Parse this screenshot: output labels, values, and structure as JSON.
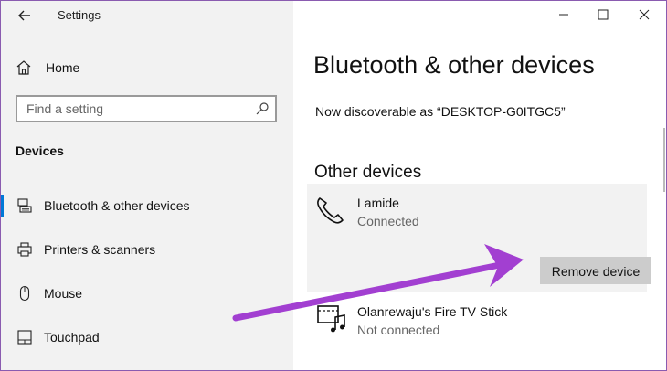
{
  "window": {
    "title": "Settings"
  },
  "sidebar": {
    "home_label": "Home",
    "search_placeholder": "Find a setting",
    "section_label": "Devices",
    "items": [
      {
        "label": "Bluetooth & other devices",
        "icon": "bluetooth-devices-icon",
        "active": true
      },
      {
        "label": "Printers & scanners",
        "icon": "printer-icon",
        "active": false
      },
      {
        "label": "Mouse",
        "icon": "mouse-icon",
        "active": false
      },
      {
        "label": "Touchpad",
        "icon": "touchpad-icon",
        "active": false
      }
    ]
  },
  "main": {
    "title": "Bluetooth & other devices",
    "discoverable_text": "Now discoverable as “DESKTOP-G0ITGC5”",
    "other_devices_heading": "Other devices",
    "devices": [
      {
        "name": "Lamide",
        "status": "Connected",
        "icon": "phone-icon"
      },
      {
        "name": "Olanrewaju's Fire TV Stick",
        "status": "Not connected",
        "icon": "media-device-icon"
      }
    ],
    "remove_button_label": "Remove device"
  },
  "colors": {
    "accent": "#0078d7",
    "annotation_arrow": "#a23fd1",
    "sidebar_bg": "#f2f2f2"
  }
}
